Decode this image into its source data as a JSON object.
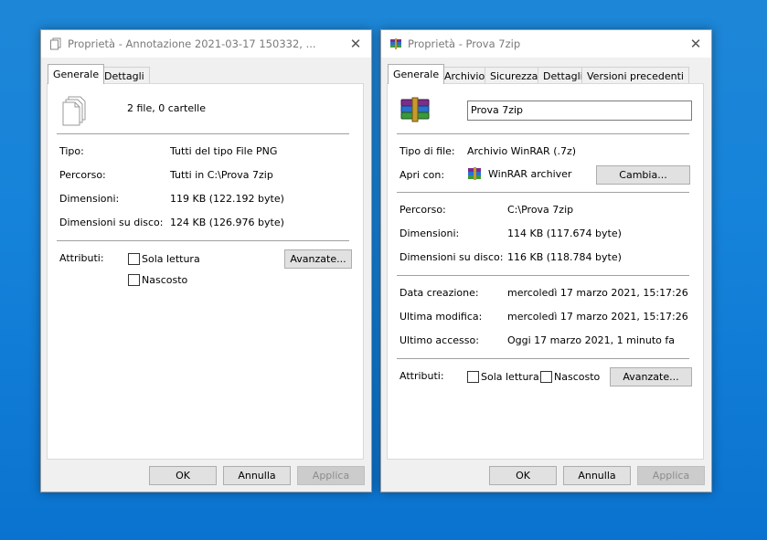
{
  "left_dialog": {
    "title": "Proprietà - Annotazione 2021-03-17 150332, ...",
    "tabs": [
      {
        "label": "Generale"
      },
      {
        "label": "Dettagli"
      }
    ],
    "summary": "2 file, 0 cartelle",
    "rows": [
      {
        "label": "Tipo:",
        "value": "Tutti del tipo File PNG"
      },
      {
        "label": "Percorso:",
        "value": "Tutti in C:\\Prova 7zip"
      },
      {
        "label": "Dimensioni:",
        "value": "119 KB (122.192 byte)"
      },
      {
        "label": "Dimensioni su disco:",
        "value": "124 KB (126.976 byte)"
      }
    ],
    "attributes_label": "Attributi:",
    "readonly_label": "Sola lettura",
    "hidden_label": "Nascosto",
    "advanced_label": "Avanzate...",
    "ok_label": "OK",
    "cancel_label": "Annulla",
    "apply_label": "Applica"
  },
  "right_dialog": {
    "title": "Proprietà - Prova 7zip",
    "tabs": [
      {
        "label": "Generale"
      },
      {
        "label": "Archivio"
      },
      {
        "label": "Sicurezza"
      },
      {
        "label": "Dettagli"
      },
      {
        "label": "Versioni precedenti"
      }
    ],
    "name_value": "Prova 7zip",
    "file_type_label": "Tipo di file:",
    "file_type_value": "Archivio WinRAR (.7z)",
    "open_with_label": "Apri con:",
    "open_with_value": "WinRAR archiver",
    "change_label": "Cambia...",
    "rows1": [
      {
        "label": "Percorso:",
        "value": "C:\\Prova 7zip"
      },
      {
        "label": "Dimensioni:",
        "value": "114 KB (117.674 byte)"
      },
      {
        "label": "Dimensioni su disco:",
        "value": "116 KB (118.784 byte)"
      }
    ],
    "rows2": [
      {
        "label": "Data creazione:",
        "value": "mercoledì 17 marzo 2021, 15:17:26"
      },
      {
        "label": "Ultima modifica:",
        "value": "mercoledì 17 marzo 2021, 15:17:26"
      },
      {
        "label": "Ultimo accesso:",
        "value": "Oggi 17 marzo 2021, 1 minuto fa"
      }
    ],
    "attributes_label": "Attributi:",
    "readonly_label": "Sola lettura",
    "hidden_label": "Nascosto",
    "advanced_label": "Avanzate...",
    "ok_label": "OK",
    "cancel_label": "Annulla",
    "apply_label": "Applica"
  },
  "colors": {
    "desktop": "#1683da",
    "dialog_bg": "#f0f0f0",
    "disabled_text": "#8c8c8c"
  }
}
